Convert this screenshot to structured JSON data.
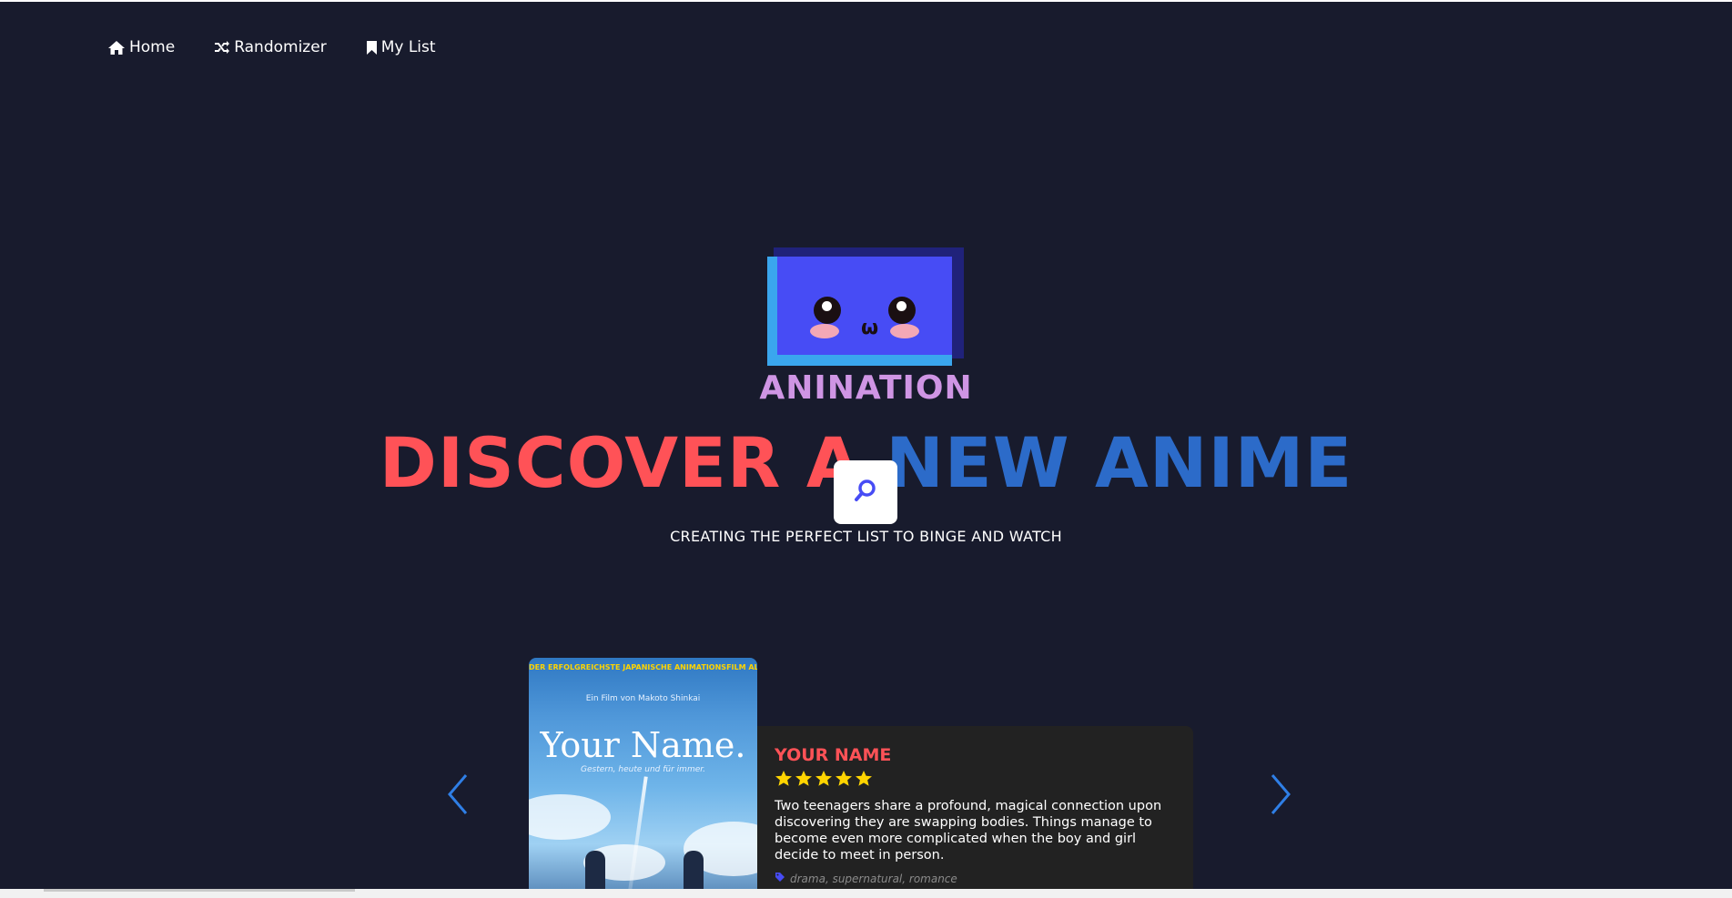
{
  "nav": {
    "items": [
      {
        "label": "Home",
        "icon": "home-icon"
      },
      {
        "label": "Randomizer",
        "icon": "shuffle-icon"
      },
      {
        "label": "My List",
        "icon": "bookmark-icon"
      }
    ]
  },
  "hero": {
    "brand": "ANINATION",
    "headline_part1": "DISCOVER A ",
    "headline_part2": "NEW ANIME",
    "tagline": "CREATING THE PERFECT LIST TO BINGE AND WATCH",
    "search_icon": "search-icon"
  },
  "colors": {
    "background": "#181b2d",
    "headline_red": "#ff5257",
    "headline_blue": "#2c6bc9",
    "brand_gradient": "#cf95e4",
    "card_bg": "#222222",
    "star": "#ffd400",
    "arrow": "#2f7fe6"
  },
  "carousel": {
    "prev_icon": "chevron-left-icon",
    "next_icon": "chevron-right-icon",
    "current": {
      "poster": {
        "banner": "DER ERFOLGREICHSTE JAPANISCHE ANIMATIONSFILM ALLER ZEITEN!",
        "credit": "Ein Film von Makoto Shinkai",
        "title": "Your Name.",
        "subtitle": "Gestern, heute und für immer."
      },
      "title": "YOUR NAME",
      "rating": 5,
      "description": "Two teenagers share a profound, magical connection upon discovering they are swapping bodies. Things manage to become even more complicated when the boy and girl decide to meet in person.",
      "tags": "drama, supernatural, romance"
    }
  }
}
